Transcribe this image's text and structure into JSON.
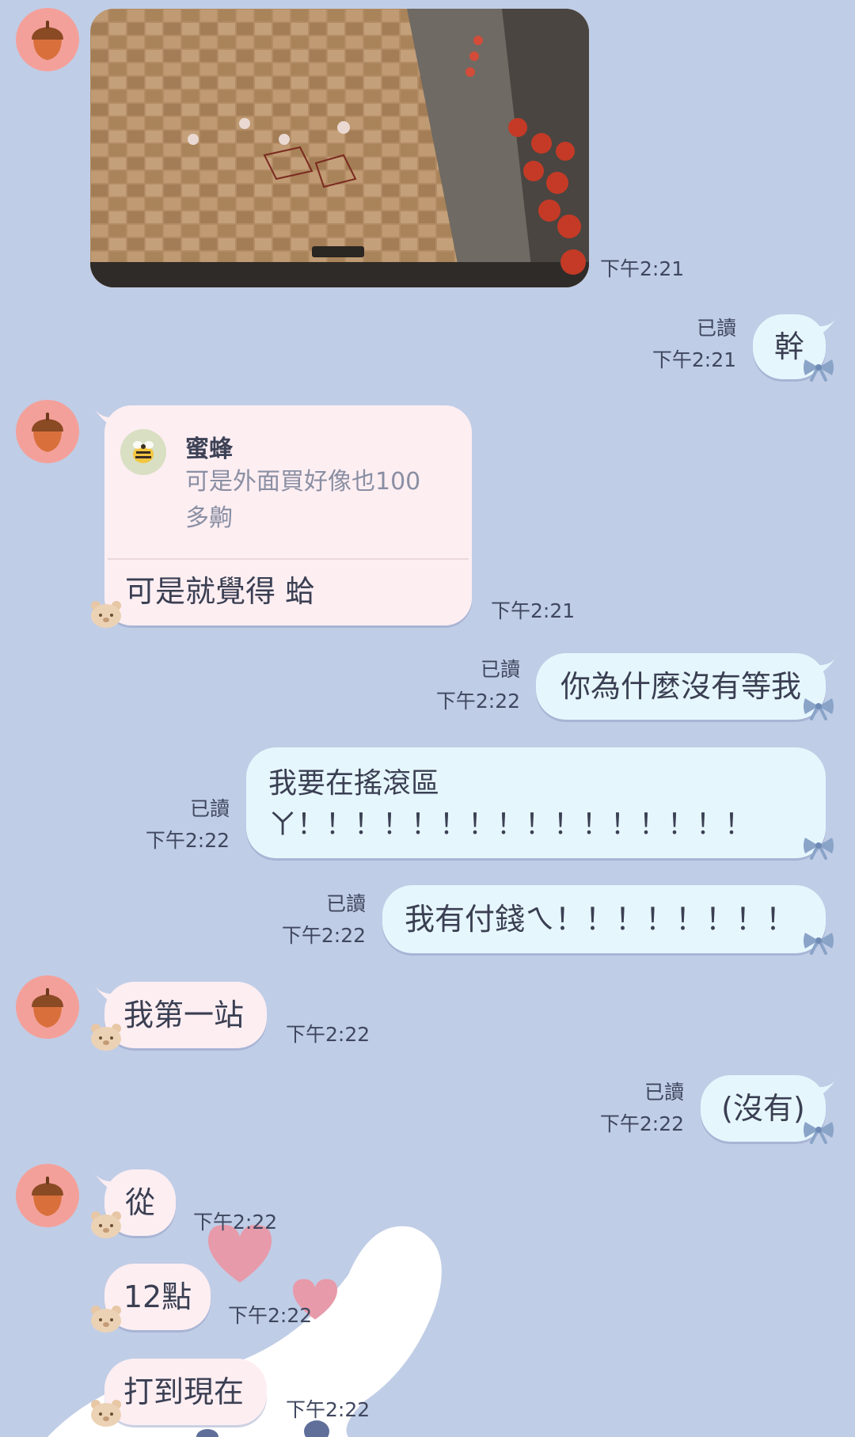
{
  "messages": {
    "m1": {
      "time": "下午2:21"
    },
    "m2": {
      "text": "幹",
      "read": "已讀",
      "time": "下午2:21"
    },
    "m3": {
      "quote_sender": "蜜蜂",
      "quote_text": "可是外面買好像也100\n多齁",
      "text": "可是就覺得 蛤",
      "time": "下午2:21"
    },
    "m4": {
      "text": "你為什麼沒有等我",
      "read": "已讀",
      "time": "下午2:22"
    },
    "m5": {
      "text": "我要在搖滾區\nㄚ！！！！！！！！！！！！！！！！",
      "read": "已讀",
      "time": "下午2:22"
    },
    "m6": {
      "text": "我有付錢ㄟ！！！！！！！！",
      "read": "已讀",
      "time": "下午2:22"
    },
    "m7": {
      "text": "我第一站",
      "time": "下午2:22"
    },
    "m8": {
      "text": "(沒有)",
      "read": "已讀",
      "time": "下午2:22"
    },
    "m9": {
      "text": "從",
      "time": "下午2:22"
    },
    "m10": {
      "text": "12點",
      "time": "下午2:22"
    },
    "m11": {
      "text": "打到現在",
      "time": "下午2:22"
    }
  },
  "icons": {
    "avatar": "acorn-icon",
    "quote_avatar": "bee-icon",
    "incoming_decor": "bear-icon",
    "outgoing_decor": "bow-icon"
  },
  "colors": {
    "background": "#c0cde6",
    "incoming_bubble": "#fdeef2",
    "outgoing_bubble": "#e6f6fd",
    "avatar_bg": "#f4a09a"
  }
}
